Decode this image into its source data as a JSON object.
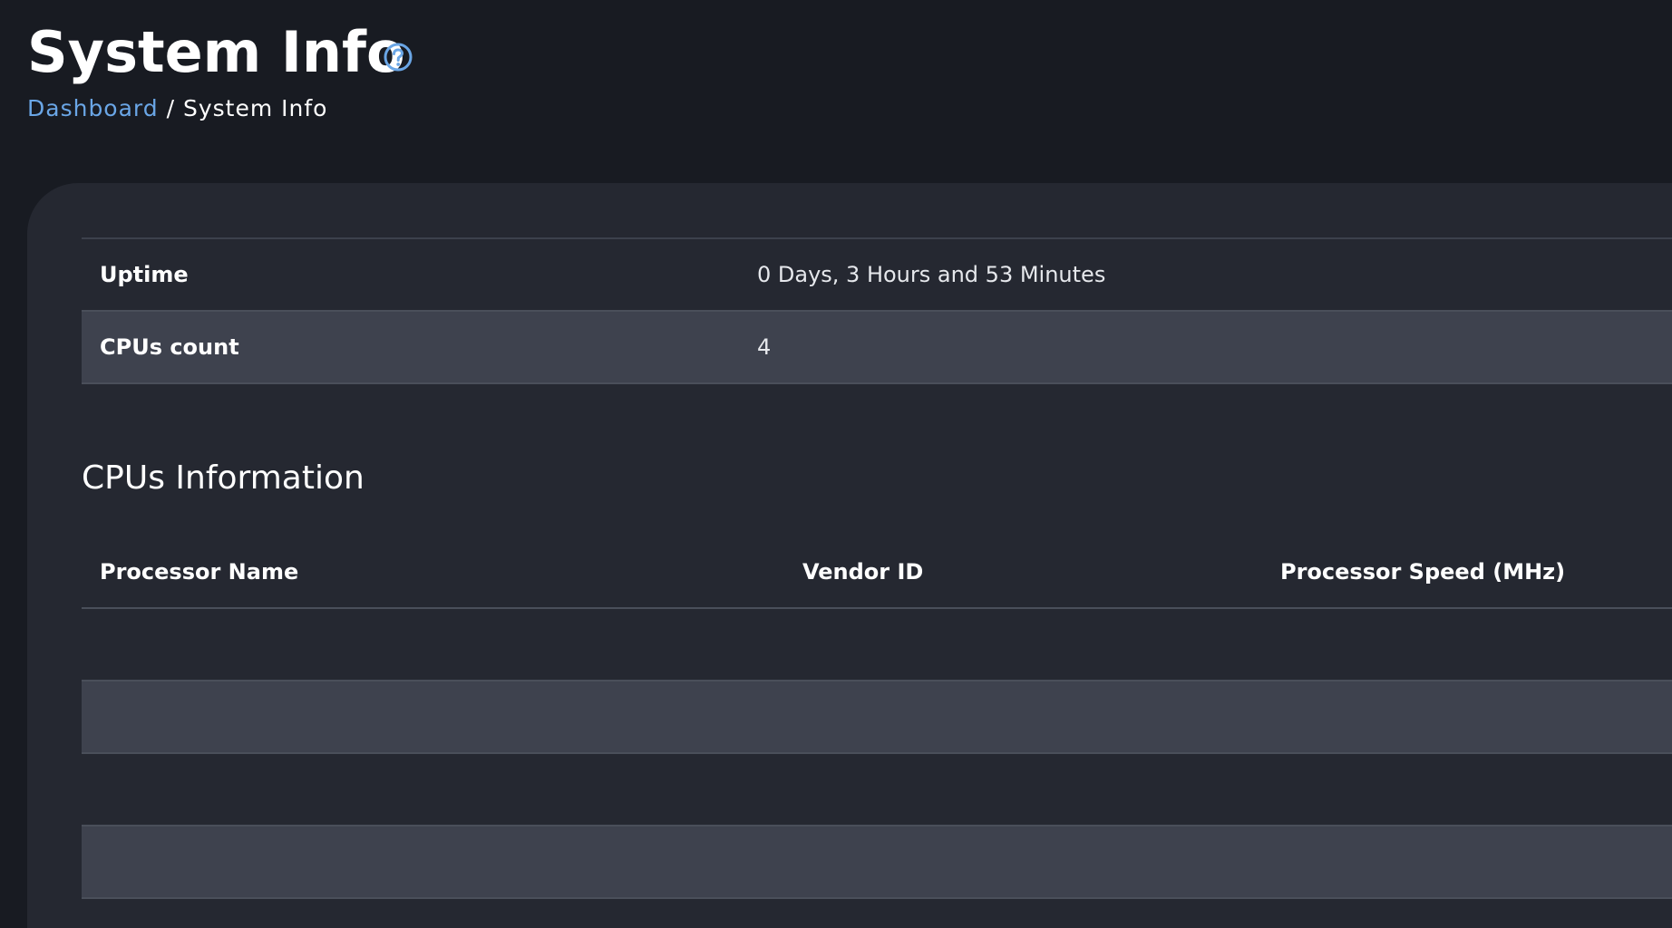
{
  "header": {
    "title": "System Info",
    "help_icon": "question-circle-icon"
  },
  "breadcrumb": {
    "home": "Dashboard",
    "separator": "/",
    "current": "System Info"
  },
  "system": {
    "rows": [
      {
        "label": "Uptime",
        "value": "0 Days, 3 Hours and 53 Minutes"
      },
      {
        "label": "CPUs count",
        "value": "4"
      }
    ]
  },
  "cpus": {
    "title": "CPUs Information",
    "columns": [
      "Processor Name",
      "Vendor ID",
      "Processor Speed (MHz)"
    ],
    "rows": [
      {
        "name": "",
        "vendor": "",
        "speed": ""
      },
      {
        "name": "",
        "vendor": "",
        "speed": ""
      },
      {
        "name": "",
        "vendor": "",
        "speed": ""
      },
      {
        "name": "",
        "vendor": "",
        "speed": ""
      }
    ]
  },
  "colors": {
    "background": "#181b22",
    "card": "#252831",
    "row_alt": "#3e424e",
    "link": "#6aa6e6"
  }
}
